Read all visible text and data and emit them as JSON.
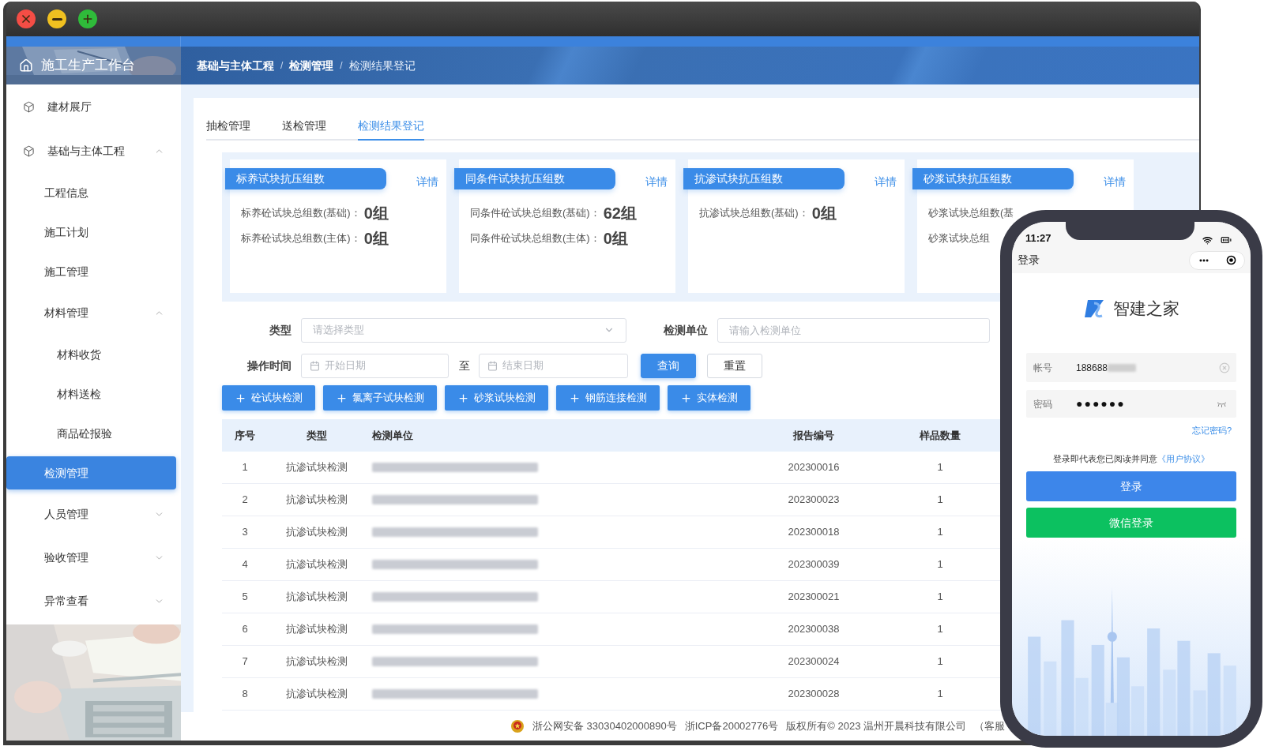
{
  "window": {
    "controls": [
      {
        "kind": "close"
      },
      {
        "kind": "minimize"
      },
      {
        "kind": "maximize"
      }
    ]
  },
  "sidebar": {
    "title": "施工生产工作台",
    "items": [
      {
        "label": "建材展厅",
        "selected": false
      },
      {
        "label": "基础与主体工程",
        "selected": false,
        "expanded": true,
        "children": [
          {
            "label": "工程信息",
            "selected": false
          },
          {
            "label": "施工计划",
            "selected": false
          },
          {
            "label": "施工管理",
            "selected": false
          },
          {
            "label": "材料管理",
            "selected": false,
            "expanded": true,
            "children": [
              {
                "label": "材料收货",
                "selected": false
              },
              {
                "label": "材料送检",
                "selected": false
              },
              {
                "label": "商品砼报验",
                "selected": false
              }
            ]
          },
          {
            "label": "检测管理",
            "selected": true
          },
          {
            "label": "人员管理",
            "selected": false,
            "expanded": false
          },
          {
            "label": "验收管理",
            "selected": false,
            "expanded": false
          },
          {
            "label": "异常查看",
            "selected": false,
            "expanded": false
          }
        ]
      }
    ]
  },
  "breadcrumb": [
    {
      "label": "基础与主体工程",
      "separator": "/",
      "current": false
    },
    {
      "label": "检测管理",
      "separator": "/",
      "current": false
    },
    {
      "label": "检测结果登记",
      "current": true
    }
  ],
  "tabs": [
    {
      "label": "抽检管理",
      "selected": false
    },
    {
      "label": "送检管理",
      "selected": false
    },
    {
      "label": "检测结果登记",
      "selected": true
    }
  ],
  "stat_cards": [
    {
      "title": "标养试块抗压组数",
      "link": "详情",
      "rows": [
        {
          "label": "标养砼试块总组数(基础)：",
          "value": "0组"
        },
        {
          "label": "标养砼试块总组数(主体)：",
          "value": "0组"
        }
      ]
    },
    {
      "title": "同条件试块抗压组数",
      "link": "详情",
      "rows": [
        {
          "label": "同条件砼试块总组数(基础)：",
          "value": "62组"
        },
        {
          "label": "同条件砼试块总组数(主体)：",
          "value": "0组"
        }
      ]
    },
    {
      "title": "抗渗试块抗压组数",
      "link": "详情",
      "rows": [
        {
          "label": "抗渗试块总组数(基础)：",
          "value": "0组"
        }
      ]
    },
    {
      "title": "砂浆试块抗压组数",
      "link": "详情",
      "rows": [
        {
          "label": "砂浆试块总组数(基"
        },
        {
          "label": "砂浆试块总组"
        }
      ]
    }
  ],
  "filters": {
    "type": {
      "label": "类型",
      "placeholder": "请选择类型"
    },
    "unit": {
      "label": "检测单位",
      "placeholder": "请输入检测单位"
    },
    "time": {
      "label": "操作时间",
      "start_placeholder": "开始日期",
      "separator": "至",
      "end_placeholder": "结束日期"
    },
    "buttons": [
      {
        "label": "查询",
        "kind": "primary"
      },
      {
        "label": "重置",
        "kind": "default"
      }
    ]
  },
  "actions": [
    "砼试块检测",
    "氯离子试块检测",
    "砂浆试块检测",
    "钢筋连接检测",
    "实体检测"
  ],
  "table": {
    "columns": [
      "序号",
      "类型",
      "检测单位",
      "报告编号",
      "样品数量"
    ],
    "rows": [
      {
        "index": "1",
        "type": "抗渗试块检测",
        "unit_redacted": true,
        "report_no": "202300016",
        "count": "1"
      },
      {
        "index": "2",
        "type": "抗渗试块检测",
        "unit_redacted": true,
        "report_no": "202300023",
        "count": "1"
      },
      {
        "index": "3",
        "type": "抗渗试块检测",
        "unit_redacted": true,
        "report_no": "202300018",
        "count": "1"
      },
      {
        "index": "4",
        "type": "抗渗试块检测",
        "unit_redacted": true,
        "report_no": "202300039",
        "count": "1"
      },
      {
        "index": "5",
        "type": "抗渗试块检测",
        "unit_redacted": true,
        "report_no": "202300021",
        "count": "1"
      },
      {
        "index": "6",
        "type": "抗渗试块检测",
        "unit_redacted": true,
        "report_no": "202300038",
        "count": "1"
      },
      {
        "index": "7",
        "type": "抗渗试块检测",
        "unit_redacted": true,
        "report_no": "202300024",
        "count": "1"
      },
      {
        "index": "8",
        "type": "抗渗试块检测",
        "unit_redacted": true,
        "report_no": "202300028",
        "count": "1"
      }
    ]
  },
  "footer": [
    {
      "text": "浙公网安备 33030402000890号",
      "kind": "police"
    },
    {
      "text": "浙ICP备20002776号",
      "kind": "plain"
    },
    {
      "text": "版权所有© 2023 温州开晨科技有限公司",
      "kind": "plain"
    },
    {
      "text": "（客服",
      "kind": "plain"
    }
  ],
  "phone": {
    "time": "11:27",
    "nav_title": "登录",
    "app_name": "智建之家",
    "account": {
      "label": "帐号",
      "value": "188688",
      "value_redacted": true
    },
    "password": {
      "label": "密码",
      "value": "●●●●●●"
    },
    "forgot": "忘记密码?",
    "agreement": {
      "text": "登录即代表您已阅读并同意",
      "link": "《用户协议》"
    },
    "buttons": [
      {
        "label": "登录",
        "kind": "primary"
      },
      {
        "label": "微信登录",
        "kind": "wechat"
      }
    ]
  }
}
